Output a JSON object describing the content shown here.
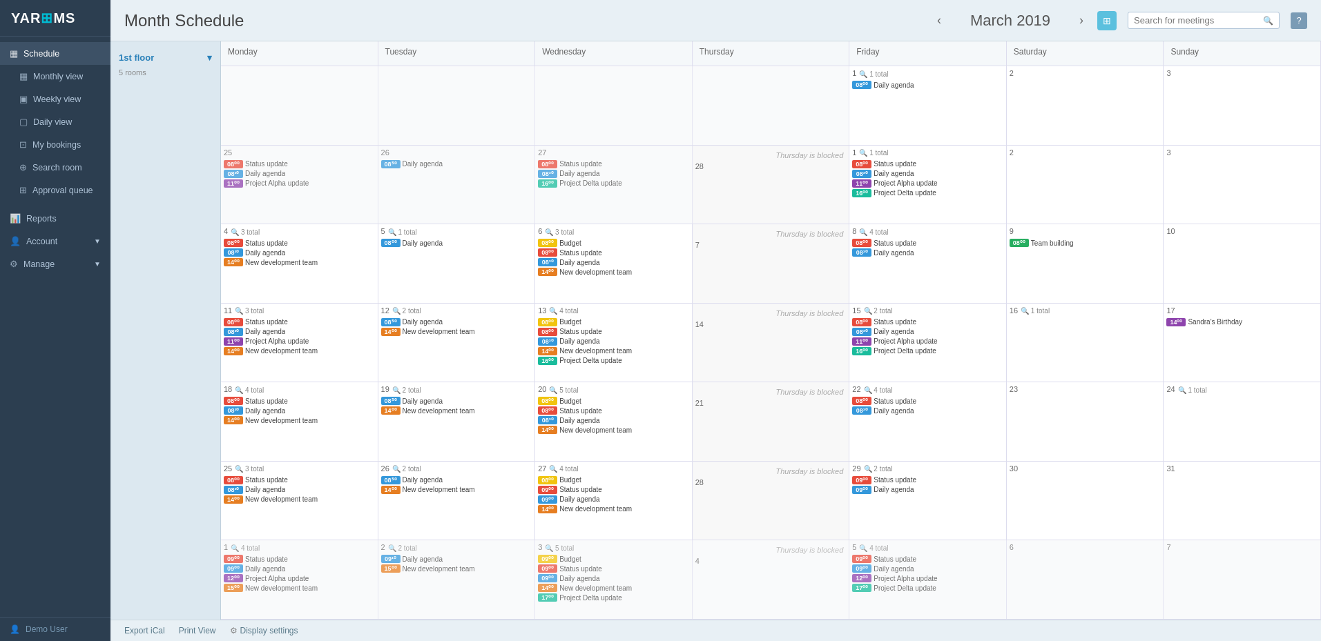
{
  "app": {
    "logo": "YAR",
    "logo_highlight": "⊞",
    "logo_full": "YARGEMS"
  },
  "sidebar": {
    "sections": [
      {
        "header": "Schedule",
        "items": [
          {
            "id": "monthly-view",
            "label": "Monthly view",
            "icon": "▦"
          },
          {
            "id": "weekly-view",
            "label": "Weekly view",
            "icon": "▣"
          },
          {
            "id": "daily-view",
            "label": "Daily view",
            "icon": "▢"
          },
          {
            "id": "my-bookings",
            "label": "My bookings",
            "icon": "⊡"
          },
          {
            "id": "search-room",
            "label": "Search room",
            "icon": "⊕"
          },
          {
            "id": "approval-queue",
            "label": "Approval queue",
            "icon": "⊞"
          }
        ]
      },
      {
        "header": "Reports",
        "items": []
      },
      {
        "header": "Account",
        "items": []
      },
      {
        "header": "Manage",
        "items": []
      }
    ],
    "user": "Demo User"
  },
  "topbar": {
    "title": "Month Schedule",
    "month": "March 2019",
    "search_placeholder": "Search for meetings"
  },
  "left_panel": {
    "floor_name": "1st floor",
    "floor_rooms": "5 rooms"
  },
  "calendar": {
    "days": [
      "Monday",
      "Tuesday",
      "Wednesday",
      "Thursday",
      "Friday",
      "Saturday",
      "Sunday"
    ],
    "weeks": [
      {
        "cells": [
          {
            "day_num": "",
            "events": [],
            "faded": true
          },
          {
            "day_num": "",
            "events": [],
            "faded": true
          },
          {
            "day_num": "",
            "events": [],
            "faded": true
          },
          {
            "day_num": "",
            "events": [],
            "faded": true
          },
          {
            "day_num": "1",
            "count": "1 total",
            "events": [
              {
                "time": "08⁰⁰",
                "name": "Daily agenda",
                "color": "t-blue"
              }
            ]
          },
          {
            "day_num": "2",
            "events": []
          },
          {
            "day_num": "3",
            "events": []
          }
        ]
      },
      {
        "cells": [
          {
            "day_num": "25",
            "count": "",
            "faded": true,
            "events": [
              {
                "time": "08⁰⁰",
                "name": "Status update",
                "color": "t-red"
              },
              {
                "time": "08³⁰",
                "name": "Daily agenda",
                "color": "t-blue"
              },
              {
                "time": "11⁰⁰",
                "name": "Project Alpha update",
                "color": "t-purple"
              }
            ]
          },
          {
            "day_num": "26",
            "count": "",
            "faded": true,
            "events": [
              {
                "time": "08⁵⁰",
                "name": "Daily agenda",
                "color": "t-blue"
              }
            ]
          },
          {
            "day_num": "27",
            "count": "",
            "faded": true,
            "events": [
              {
                "time": "08⁰⁰",
                "name": "Status update",
                "color": "t-red"
              },
              {
                "time": "08³⁰",
                "name": "Daily agenda",
                "color": "t-blue"
              },
              {
                "time": "16⁰⁰",
                "name": "Project Delta update",
                "color": "t-teal"
              }
            ]
          },
          {
            "day_num": "28",
            "count": "",
            "blocked": true,
            "blocked_text": "Thursday is blocked",
            "events": []
          },
          {
            "day_num": "1",
            "count": "1 total",
            "events": [
              {
                "time": "08⁰⁰",
                "name": "Status update",
                "color": "t-red"
              },
              {
                "time": "08³⁰",
                "name": "Daily agenda",
                "color": "t-blue"
              },
              {
                "time": "11⁰⁰",
                "name": "Project Alpha update",
                "color": "t-purple"
              },
              {
                "time": "16⁰⁰",
                "name": "Project Delta update",
                "color": "t-teal"
              }
            ]
          },
          {
            "day_num": "2",
            "events": []
          },
          {
            "day_num": "3",
            "events": []
          }
        ]
      },
      {
        "cells": [
          {
            "day_num": "4",
            "count": "3 total",
            "events": [
              {
                "time": "08⁰⁰",
                "name": "Status update",
                "color": "t-red"
              },
              {
                "time": "08³⁰",
                "name": "Daily agenda",
                "color": "t-blue"
              },
              {
                "time": "14⁰⁰",
                "name": "New development team",
                "color": "t-orange"
              }
            ]
          },
          {
            "day_num": "5",
            "count": "1 total",
            "events": [
              {
                "time": "08⁰⁰",
                "name": "Daily agenda",
                "color": "t-blue"
              }
            ]
          },
          {
            "day_num": "6",
            "count": "3 total",
            "events": [
              {
                "time": "08⁰⁰",
                "name": "Budget",
                "color": "t-yellow"
              },
              {
                "time": "08⁰⁰",
                "name": "Status update",
                "color": "t-red"
              },
              {
                "time": "08³⁰",
                "name": "Daily agenda",
                "color": "t-blue"
              },
              {
                "time": "14⁰⁰",
                "name": "New development team",
                "color": "t-orange"
              }
            ]
          },
          {
            "day_num": "7",
            "count": "",
            "blocked": true,
            "blocked_text": "Thursday is blocked",
            "events": []
          },
          {
            "day_num": "8",
            "count": "4 total",
            "events": [
              {
                "time": "08⁰⁰",
                "name": "Status update",
                "color": "t-red"
              },
              {
                "time": "08³⁰",
                "name": "Daily agenda",
                "color": "t-blue"
              }
            ]
          },
          {
            "day_num": "9",
            "count": "",
            "events": [
              {
                "time": "08⁰⁰",
                "name": "Team building",
                "color": "t-green"
              }
            ]
          },
          {
            "day_num": "10",
            "events": []
          }
        ]
      },
      {
        "cells": [
          {
            "day_num": "11",
            "count": "3 total",
            "events": [
              {
                "time": "08⁰⁰",
                "name": "Status update",
                "color": "t-red"
              },
              {
                "time": "08³⁰",
                "name": "Daily agenda",
                "color": "t-blue"
              },
              {
                "time": "11⁰⁰",
                "name": "Project Alpha update",
                "color": "t-purple"
              },
              {
                "time": "14⁰⁰",
                "name": "New development team",
                "color": "t-orange"
              }
            ]
          },
          {
            "day_num": "12",
            "count": "2 total",
            "events": [
              {
                "time": "08⁵⁰",
                "name": "Daily agenda",
                "color": "t-blue"
              },
              {
                "time": "14⁰⁰",
                "name": "New development team",
                "color": "t-orange"
              }
            ]
          },
          {
            "day_num": "13",
            "count": "4 total",
            "events": [
              {
                "time": "08⁰⁰",
                "name": "Budget",
                "color": "t-yellow"
              },
              {
                "time": "08⁰⁰",
                "name": "Status update",
                "color": "t-red"
              },
              {
                "time": "08³⁰",
                "name": "Daily agenda",
                "color": "t-blue"
              },
              {
                "time": "14⁰⁰",
                "name": "New development team",
                "color": "t-orange"
              },
              {
                "time": "16⁰⁰",
                "name": "Project Delta update",
                "color": "t-teal"
              }
            ]
          },
          {
            "day_num": "14",
            "count": "",
            "blocked": true,
            "blocked_text": "Thursday is blocked",
            "events": []
          },
          {
            "day_num": "15",
            "count": "2 total",
            "events": [
              {
                "time": "08⁰⁰",
                "name": "Status update",
                "color": "t-red"
              },
              {
                "time": "08³⁰",
                "name": "Daily agenda",
                "color": "t-blue"
              },
              {
                "time": "11⁰⁰",
                "name": "Project Alpha update",
                "color": "t-purple"
              },
              {
                "time": "16⁰⁰",
                "name": "Project Delta update",
                "color": "t-teal"
              }
            ]
          },
          {
            "day_num": "16",
            "count": "1 total",
            "events": []
          },
          {
            "day_num": "17",
            "count": "",
            "events": [
              {
                "time": "14⁰⁰",
                "name": "Sandra's Birthday",
                "color": "t-purple"
              }
            ]
          }
        ]
      },
      {
        "cells": [
          {
            "day_num": "18",
            "count": "4 total",
            "events": [
              {
                "time": "08⁰⁰",
                "name": "Status update",
                "color": "t-red"
              },
              {
                "time": "08³⁰",
                "name": "Daily agenda",
                "color": "t-blue"
              },
              {
                "time": "14⁰⁰",
                "name": "New development team",
                "color": "t-orange"
              }
            ]
          },
          {
            "day_num": "19",
            "count": "2 total",
            "events": [
              {
                "time": "08⁵⁰",
                "name": "Daily agenda",
                "color": "t-blue"
              },
              {
                "time": "14⁰⁰",
                "name": "New development team",
                "color": "t-orange"
              }
            ]
          },
          {
            "day_num": "20",
            "count": "5 total",
            "events": [
              {
                "time": "08⁰⁰",
                "name": "Budget",
                "color": "t-yellow"
              },
              {
                "time": "08⁰⁰",
                "name": "Status update",
                "color": "t-red"
              },
              {
                "time": "08³⁰",
                "name": "Daily agenda",
                "color": "t-blue"
              },
              {
                "time": "14⁰⁰",
                "name": "New development team",
                "color": "t-orange"
              }
            ]
          },
          {
            "day_num": "21",
            "count": "",
            "blocked": true,
            "blocked_text": "Thursday is blocked",
            "today_yellow": true,
            "events": []
          },
          {
            "day_num": "22",
            "count": "4 total",
            "events": [
              {
                "time": "08⁰⁰",
                "name": "Status update",
                "color": "t-red"
              },
              {
                "time": "08³⁰",
                "name": "Daily agenda",
                "color": "t-blue"
              }
            ]
          },
          {
            "day_num": "23",
            "events": []
          },
          {
            "day_num": "24",
            "count": "1 total",
            "events": []
          }
        ]
      },
      {
        "cells": [
          {
            "day_num": "25",
            "count": "3 total",
            "events": [
              {
                "time": "08⁰⁰",
                "name": "Status update",
                "color": "t-red"
              },
              {
                "time": "08³⁰",
                "name": "Daily agenda",
                "color": "t-blue"
              },
              {
                "time": "14⁰⁰",
                "name": "New development team",
                "color": "t-orange"
              }
            ]
          },
          {
            "day_num": "26",
            "count": "2 total",
            "events": [
              {
                "time": "08⁵⁰",
                "name": "Daily agenda",
                "color": "t-blue"
              },
              {
                "time": "14⁰⁰",
                "name": "New development team",
                "color": "t-orange"
              }
            ]
          },
          {
            "day_num": "27",
            "count": "4 total",
            "events": [
              {
                "time": "08⁰⁰",
                "name": "Budget",
                "color": "t-yellow"
              },
              {
                "time": "09⁰⁰",
                "name": "Status update",
                "color": "t-red"
              },
              {
                "time": "09⁰⁰",
                "name": "Daily agenda",
                "color": "t-blue"
              },
              {
                "time": "14⁰⁰",
                "name": "New development team",
                "color": "t-orange"
              }
            ]
          },
          {
            "day_num": "28",
            "count": "",
            "blocked": true,
            "blocked_text": "Thursday is blocked",
            "events": []
          },
          {
            "day_num": "29",
            "count": "2 total",
            "events": [
              {
                "time": "09⁰⁰",
                "name": "Status update",
                "color": "t-red"
              },
              {
                "time": "09⁰⁰",
                "name": "Daily agenda",
                "color": "t-blue"
              }
            ]
          },
          {
            "day_num": "30",
            "events": []
          },
          {
            "day_num": "31",
            "events": []
          }
        ]
      },
      {
        "cells": [
          {
            "day_num": "1",
            "count": "4 total",
            "faded": true,
            "events": [
              {
                "time": "09⁰⁰",
                "name": "Status update",
                "color": "t-red"
              },
              {
                "time": "09⁰⁰",
                "name": "Daily agenda",
                "color": "t-blue"
              },
              {
                "time": "12⁰⁰",
                "name": "Project Alpha update",
                "color": "t-purple"
              },
              {
                "time": "15⁰⁰",
                "name": "New development team",
                "color": "t-orange"
              }
            ]
          },
          {
            "day_num": "2",
            "count": "2 total",
            "faded": true,
            "events": [
              {
                "time": "09¹⁰",
                "name": "Daily agenda",
                "color": "t-blue"
              },
              {
                "time": "15⁰⁰",
                "name": "New development team",
                "color": "t-orange"
              }
            ]
          },
          {
            "day_num": "3",
            "count": "5 total",
            "faded": true,
            "events": [
              {
                "time": "09⁰⁰",
                "name": "Budget",
                "color": "t-yellow"
              },
              {
                "time": "09⁰⁰",
                "name": "Status update",
                "color": "t-red"
              },
              {
                "time": "09⁰⁰",
                "name": "Daily agenda",
                "color": "t-blue"
              },
              {
                "time": "14⁰⁰",
                "name": "New development team",
                "color": "t-orange"
              },
              {
                "time": "17⁰⁰",
                "name": "Project Delta update",
                "color": "t-teal"
              }
            ]
          },
          {
            "day_num": "4",
            "count": "",
            "blocked": true,
            "blocked_text": "Thursday is blocked",
            "faded": true,
            "events": []
          },
          {
            "day_num": "5",
            "count": "4 total",
            "faded": true,
            "events": [
              {
                "time": "09⁰⁰",
                "name": "Status update",
                "color": "t-red"
              },
              {
                "time": "09⁰⁰",
                "name": "Daily agenda",
                "color": "t-blue"
              },
              {
                "time": "12⁰⁰",
                "name": "Project Alpha update",
                "color": "t-purple"
              },
              {
                "time": "17⁰⁰",
                "name": "Project Delta update",
                "color": "t-teal"
              }
            ]
          },
          {
            "day_num": "6",
            "faded": true,
            "events": []
          },
          {
            "day_num": "7",
            "faded": true,
            "events": []
          }
        ]
      }
    ]
  },
  "footer": {
    "export_ical": "Export iCal",
    "print_view": "Print View",
    "display_settings": "Display settings"
  }
}
